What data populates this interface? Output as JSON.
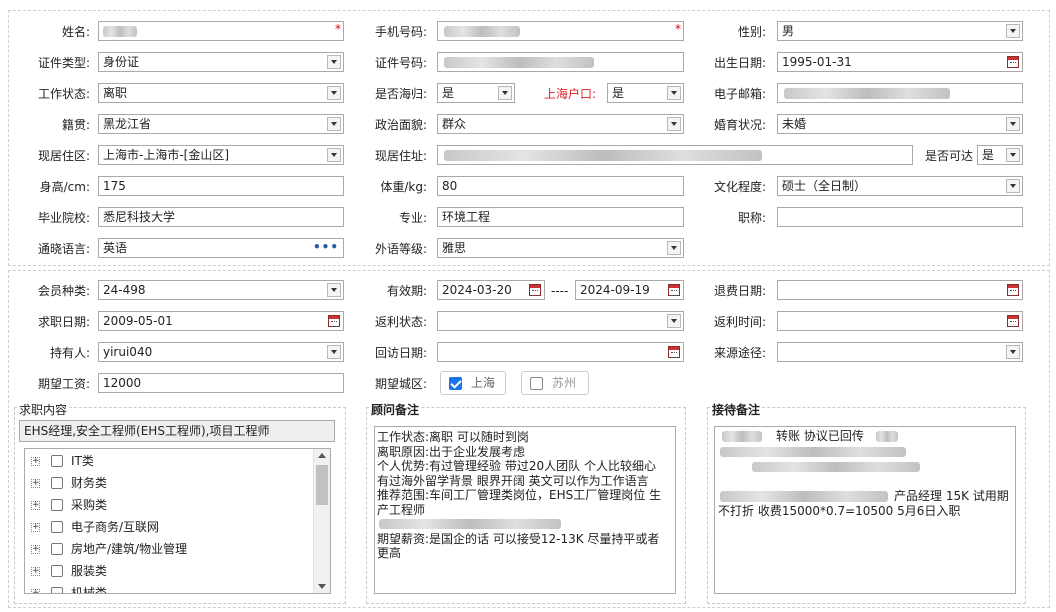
{
  "section1": {
    "name_label": "姓名:",
    "mobile_label": "手机号码:",
    "gender_label": "性别:",
    "gender_value": "男",
    "id_type_label": "证件类型:",
    "id_type_value": "身份证",
    "id_no_label": "证件号码:",
    "birth_label": "出生日期:",
    "birth_value": "1995-01-31",
    "work_status_label": "工作状态:",
    "work_status_value": "离职",
    "returnee_label": "是否海归:",
    "returnee_value": "是",
    "hukou_label": "上海户口:",
    "hukou_value": "是",
    "email_label": "电子邮箱:",
    "native_label": "籍贯:",
    "native_value": "黑龙江省",
    "politics_label": "政治面貌:",
    "politics_value": "群众",
    "marital_label": "婚育状况:",
    "marital_value": "未婚",
    "residence_label": "现居住区:",
    "residence_value": "上海市-上海市-[金山区]",
    "address_label": "现居住址:",
    "reachable_label": "是否可达",
    "reachable_value": "是",
    "height_label": "身高/cm:",
    "height_value": "175",
    "weight_label": "体重/kg:",
    "weight_value": "80",
    "education_label": "文化程度:",
    "education_value": "硕士（全日制）",
    "school_label": "毕业院校:",
    "school_value": "悉尼科技大学",
    "major_label": "专业:",
    "major_value": "环境工程",
    "title_label": "职称:",
    "language_label": "通晓语言:",
    "language_value": "英语",
    "foreign_level_label": "外语等级:",
    "foreign_level_value": "雅思"
  },
  "section2": {
    "member_type_label": "会员种类:",
    "member_type_value": "24-498",
    "validity_label": "有效期:",
    "validity_start": "2024-03-20",
    "validity_sep": "----",
    "validity_end": "2024-09-19",
    "refund_date_label": "退费日期:",
    "job_date_label": "求职日期:",
    "job_date_value": "2009-05-01",
    "rebate_status_label": "返利状态:",
    "rebate_time_label": "返利时间:",
    "holder_label": "持有人:",
    "holder_value": "yirui040",
    "visit_date_label": "回访日期:",
    "source_label": "来源途径:",
    "salary_label": "期望工资:",
    "salary_value": "12000",
    "city_label": "期望城区:",
    "city_options": [
      {
        "label": "上海",
        "checked": true
      },
      {
        "label": "苏州",
        "checked": false
      }
    ]
  },
  "job_panel": {
    "title": "求职内容",
    "selected": "EHS经理,安全工程师(EHS工程师),项目工程师",
    "categories": [
      "IT类",
      "财务类",
      "采购类",
      "电子商务/互联网",
      "房地产/建筑/物业管理",
      "服装类",
      "机械类"
    ]
  },
  "advisor_panel": {
    "title": "顾问备注",
    "lines": [
      "工作状态:离职 可以随时到岗",
      "离职原因:出于企业发展考虑",
      "个人优势:有过管理经验 带过20人团队 个人比较细心",
      "有过海外留学背景 眼界开阔 英文可以作为工作语言",
      "推荐范围:车间工厂管理类岗位，EHS工厂管理岗位 生",
      "产工程师",
      "",
      "期望薪资:是国企的话 可以接受12-13K 尽量持平或者",
      "更高"
    ]
  },
  "reception_panel": {
    "title": "接待备注",
    "line1_visible": "转账  协议已回传",
    "line2_visible": "产品经理 15K 试用期",
    "line3": "不打折 收费15000*0.7=10500   5月6日入职"
  },
  "colors": {
    "required": "#dd0000",
    "hukou_label": "#d22222",
    "checkbox_on": "#1a73e8",
    "link_dots": "#2a5aa8"
  }
}
